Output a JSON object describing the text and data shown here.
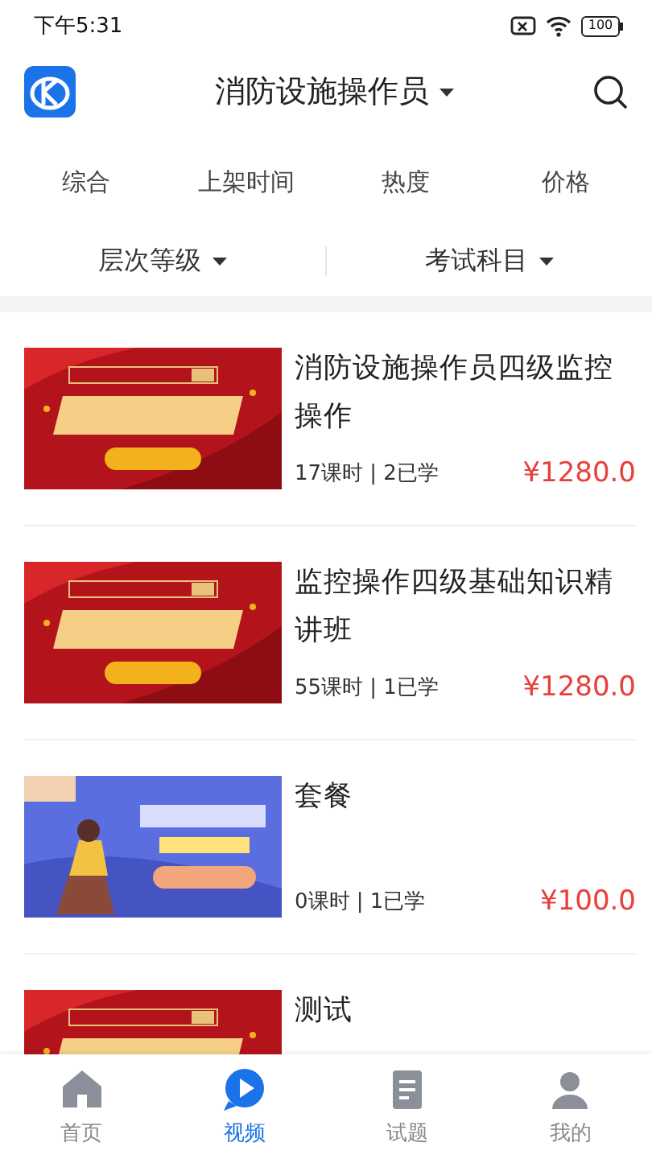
{
  "status_bar": {
    "time": "下午5:31",
    "battery": "100"
  },
  "header": {
    "title": "消防设施操作员"
  },
  "sort_options": [
    {
      "label": "综合",
      "selected": false
    },
    {
      "label": "上架时间",
      "selected": false
    },
    {
      "label": "热度",
      "selected": false
    },
    {
      "label": "价格",
      "selected": false
    }
  ],
  "filters": [
    {
      "label": "层次等级"
    },
    {
      "label": "考试科目"
    }
  ],
  "courses": [
    {
      "title": "消防设施操作员四级监控操作",
      "meta": "17课时 | 2已学",
      "price": "¥1280.0"
    },
    {
      "title": "监控操作四级基础知识精讲班",
      "meta": "55课时 | 1已学",
      "price": "¥1280.0"
    },
    {
      "title": "套餐",
      "meta": "0课时 | 1已学",
      "price": "¥100.0"
    },
    {
      "title": "测试"
    }
  ],
  "tab_bar": [
    {
      "label": "首页",
      "selected": false
    },
    {
      "label": "视频",
      "selected": true
    },
    {
      "label": "试题",
      "selected": false
    },
    {
      "label": "我的",
      "selected": false
    }
  ]
}
